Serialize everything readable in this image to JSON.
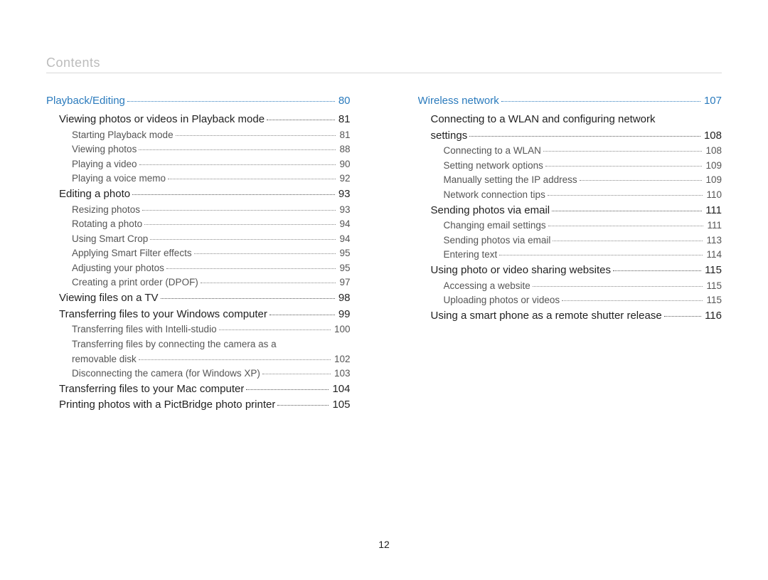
{
  "header": "Contents",
  "page_number": "12",
  "columns": [
    [
      {
        "level": 0,
        "label": "Playback/Editing",
        "page": "80"
      },
      {
        "level": 1,
        "label": "Viewing photos or videos in Playback mode",
        "page": "81"
      },
      {
        "level": 2,
        "label": "Starting Playback mode",
        "page": "81"
      },
      {
        "level": 2,
        "label": "Viewing photos",
        "page": "88"
      },
      {
        "level": 2,
        "label": "Playing a video",
        "page": "90"
      },
      {
        "level": 2,
        "label": "Playing a voice memo",
        "page": "92"
      },
      {
        "level": 1,
        "label": "Editing a photo",
        "page": "93"
      },
      {
        "level": 2,
        "label": "Resizing photos",
        "page": "93"
      },
      {
        "level": 2,
        "label": "Rotating a photo",
        "page": "94"
      },
      {
        "level": 2,
        "label": "Using Smart Crop",
        "page": "94"
      },
      {
        "level": 2,
        "label": "Applying Smart Filter effects",
        "page": "95"
      },
      {
        "level": 2,
        "label": "Adjusting your photos",
        "page": "95"
      },
      {
        "level": 2,
        "label": "Creating a print order (DPOF)",
        "page": "97"
      },
      {
        "level": 1,
        "label": "Viewing files on a TV",
        "page": "98"
      },
      {
        "level": 1,
        "label": "Transferring files to your Windows computer",
        "page": "99"
      },
      {
        "level": 2,
        "label": "Transferring files with Intelli-studio",
        "page": "100"
      },
      {
        "level": 2,
        "wrap": true,
        "label_line1": "Transferring files by connecting the camera as a",
        "label_line2": "removable disk",
        "page": "102"
      },
      {
        "level": 2,
        "label": "Disconnecting the camera (for Windows XP)",
        "page": "103"
      },
      {
        "level": 1,
        "label": "Transferring files to your Mac computer",
        "page": "104"
      },
      {
        "level": 1,
        "label": "Printing photos with a PictBridge photo printer",
        "page": "105"
      }
    ],
    [
      {
        "level": 0,
        "label": "Wireless network",
        "page": "107"
      },
      {
        "level": 1,
        "wrap": true,
        "label_line1": "Connecting to a WLAN and configuring network",
        "label_line2": "settings",
        "page": "108"
      },
      {
        "level": 2,
        "label": "Connecting to a WLAN",
        "page": "108"
      },
      {
        "level": 2,
        "label": "Setting network options",
        "page": "109"
      },
      {
        "level": 2,
        "label": "Manually setting the IP address",
        "page": "109"
      },
      {
        "level": 2,
        "label": "Network connection tips",
        "page": "110"
      },
      {
        "level": 1,
        "label": "Sending photos via email",
        "page": "111"
      },
      {
        "level": 2,
        "label": "Changing email settings",
        "page": "111"
      },
      {
        "level": 2,
        "label": "Sending photos via email",
        "page": "113"
      },
      {
        "level": 2,
        "label": "Entering text",
        "page": "114"
      },
      {
        "level": 1,
        "label": "Using photo or video sharing websites",
        "page": "115"
      },
      {
        "level": 2,
        "label": "Accessing a website",
        "page": "115"
      },
      {
        "level": 2,
        "label": "Uploading photos or videos",
        "page": "115"
      },
      {
        "level": 1,
        "label": "Using a smart phone as a remote shutter release",
        "page": "116"
      }
    ]
  ]
}
